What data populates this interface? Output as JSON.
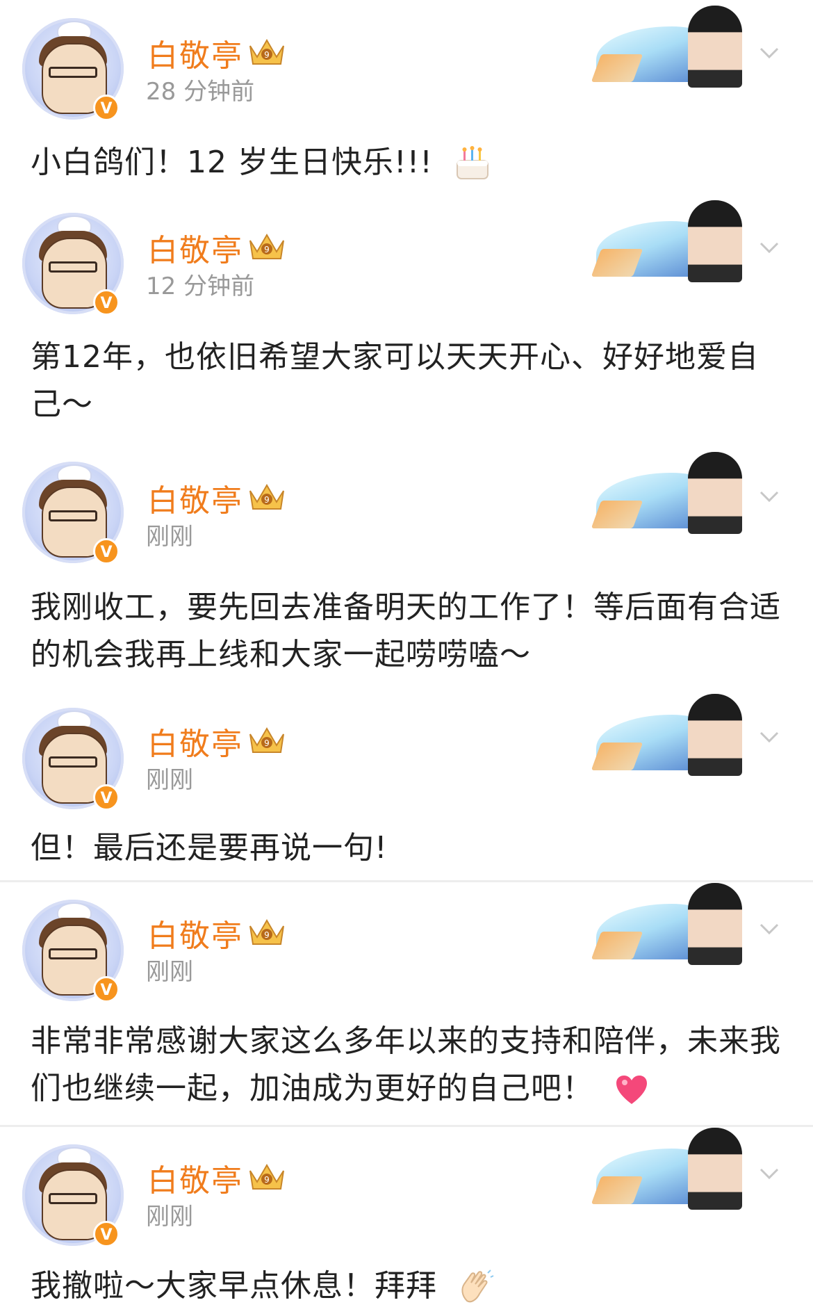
{
  "posts": [
    {
      "name": "白敬亭",
      "time": "28 分钟前",
      "text": "小白鸽们！12 岁生日快乐!!!",
      "emoji": "cake-emoji"
    },
    {
      "name": "白敬亭",
      "time": "12 分钟前",
      "text": "第12年，也依旧希望大家可以天天开心、好好地爱自己～",
      "emoji": ""
    },
    {
      "name": "白敬亭",
      "time": "刚刚",
      "text": "我刚收工，要先回去准备明天的工作了！等后面有合适的机会我再上线和大家一起唠唠嗑～",
      "emoji": ""
    },
    {
      "name": "白敬亭",
      "time": "刚刚",
      "text": "但！最后还是要再说一句!",
      "emoji": ""
    },
    {
      "name": "白敬亭",
      "time": "刚刚",
      "text": "非常非常感谢大家这么多年以来的支持和陪伴，未来我们也继续一起，加油成为更好的自己吧！",
      "emoji": "heart-emoji"
    },
    {
      "name": "白敬亭",
      "time": "刚刚",
      "text": "我撤啦～大家早点休息！拜拜",
      "emoji": "wave-emoji"
    }
  ],
  "verified_badge": "V",
  "colors": {
    "name": "#f07c1c",
    "time": "#999999",
    "text": "#222222",
    "badge": "#f7941e"
  }
}
